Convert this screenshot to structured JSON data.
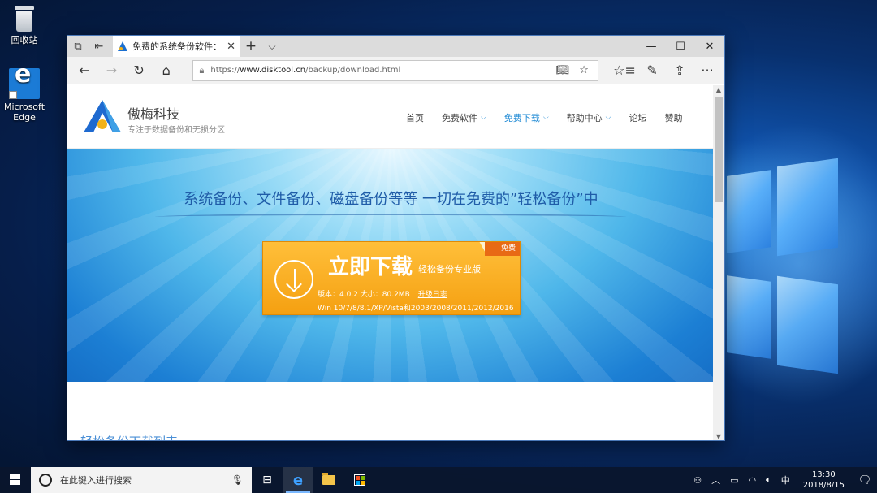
{
  "desktop": {
    "icons": [
      {
        "label": "回收站"
      },
      {
        "label": "Microsoft Edge"
      }
    ]
  },
  "browser": {
    "tab_title": "免费的系统备份软件：轻",
    "address": {
      "prefix": "https://",
      "host": "www.disktool.cn",
      "path": "/backup/download.html"
    }
  },
  "site": {
    "brand": "傲梅科技",
    "slogan": "专注于数据备份和无损分区",
    "menu": [
      {
        "label": "首页",
        "dropdown": false,
        "active": false
      },
      {
        "label": "免费软件",
        "dropdown": true,
        "active": false
      },
      {
        "label": "免费下载",
        "dropdown": true,
        "active": true
      },
      {
        "label": "帮助中心",
        "dropdown": true,
        "active": false
      },
      {
        "label": "论坛",
        "dropdown": false,
        "active": false
      },
      {
        "label": "赞助",
        "dropdown": false,
        "active": false
      }
    ],
    "headline": "系统备份、文件备份、磁盘备份等等 一切在免费的”轻松备份”中",
    "download": {
      "label": "立即下载",
      "product": "轻松备份专业版",
      "badge": "免费",
      "version": "版本：4.0.2 大小：80.2MB",
      "changelog": "升级日志",
      "os": "Win 10/7/8/8.1/XP/Vista和2003/2008/2011/2012/2016"
    },
    "list_heading": "轻松备份下载列表"
  },
  "taskbar": {
    "search_placeholder": "在此键入进行搜索",
    "ime": "中",
    "time": "13:30",
    "date": "2018/8/15"
  },
  "colors": {
    "accent": "#1b88d4",
    "download_button": "#f5a011",
    "badge": "#e86a15"
  }
}
